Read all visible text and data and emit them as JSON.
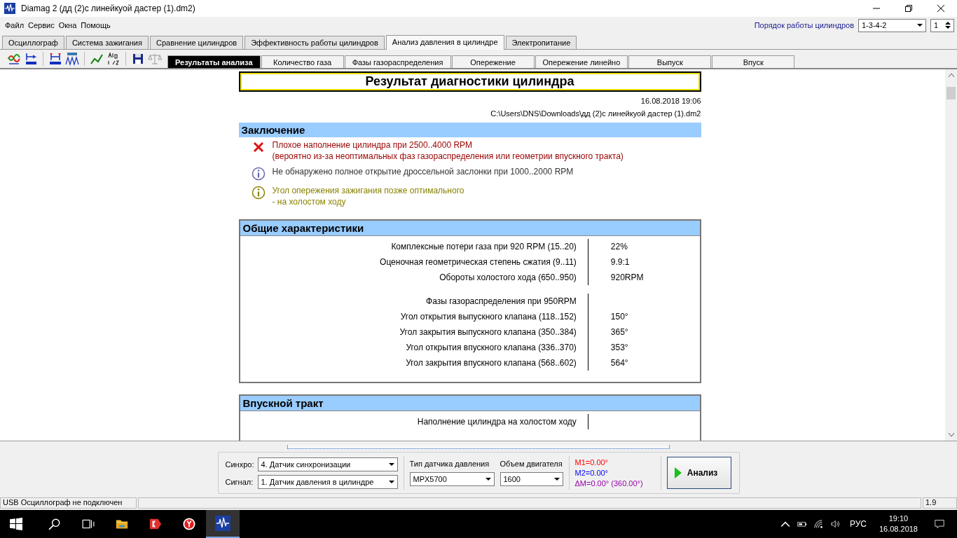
{
  "window": {
    "title": "Diamag 2 (дд (2)с линейкуой дастер (1).dm2)"
  },
  "menu": [
    "Файл",
    "Сервис",
    "Окна",
    "Помощь"
  ],
  "cylinder_order": {
    "label": "Порядок работы цилиндров",
    "value": "1-3-4-2",
    "cylinder": "1"
  },
  "tabs": [
    {
      "label": "Осциллограф",
      "selected": false
    },
    {
      "label": "Система зажигания",
      "selected": false
    },
    {
      "label": "Сравнение цилиндров",
      "selected": false
    },
    {
      "label": "Эффективность работы цилиндров",
      "selected": false
    },
    {
      "label": "Анализ давления в цилиндре",
      "selected": true
    },
    {
      "label": "Электропитание",
      "selected": false
    }
  ],
  "subtabs": [
    {
      "label": "Результаты анализа",
      "selected": true
    },
    {
      "label": "Количество газа",
      "selected": false
    },
    {
      "label": "Фазы газораспределения",
      "selected": false
    },
    {
      "label": "Опережение",
      "selected": false
    },
    {
      "label": "Опережение линейно",
      "selected": false
    },
    {
      "label": "Выпуск",
      "selected": false
    },
    {
      "label": "Впуск",
      "selected": false
    }
  ],
  "report": {
    "title": "Результат диагностики цилиндра",
    "date": "16.08.2018 19:06",
    "path": "C:\\Users\\DNS\\Downloads\\дд (2)с линейкуой дастер (1).dm2",
    "conclusion": {
      "title": "Заключение",
      "items": [
        {
          "kind": "error",
          "lines": [
            "Плохое наполнение цилиндра при 2500..4000 RPM",
            "(вероятно из-за неоптимальных фаз газораспределения или геометрии впускного тракта)"
          ]
        },
        {
          "kind": "info",
          "lines": [
            "Не обнаружено полное открытие дроссельной заслонки при 1000..2000 RPM"
          ]
        },
        {
          "kind": "warning",
          "lines": [
            "Угол опережения зажигания позже оптимального",
            "- на холостом ходу"
          ]
        }
      ]
    },
    "sections": [
      {
        "title": "Общие характеристики",
        "groups": [
          [
            {
              "label": "Комплексные потери газа при 920 RPM (15..20)",
              "value": "22%"
            },
            {
              "label": "Оценочная геометрическая степень сжатия (9..11)",
              "value": "9.9:1"
            },
            {
              "label": "Обороты холостого хода (650..950)",
              "value": "920RPM"
            }
          ],
          [
            {
              "label": "Фазы газораспределения при 950RPM"
            },
            {
              "label": "Угол открытия выпускного клапана (118..152)",
              "value": "150°"
            },
            {
              "label": "Угол закрытия выпускного клапана (350..384)",
              "value": "365°"
            },
            {
              "label": "Угол открытия впускного клапана (336..370)",
              "value": "353°"
            },
            {
              "label": "Угол закрытия впускного клапана (568..602)",
              "value": "564°"
            }
          ]
        ]
      },
      {
        "title": "Впускной тракт",
        "groups": [
          [
            {
              "label": "Наполнение цилиндра на холостом ходу"
            }
          ]
        ]
      }
    ]
  },
  "controls": {
    "sync_label": "Синхро:",
    "sync": "4.  Датчик синхронизации",
    "signal_label": "Сигнал:",
    "signal": "1.  Датчик давления в цилиндре",
    "sensor_label": "Тип датчика давления",
    "sensor": "MPX5700",
    "volume_label": "Объем двигателя",
    "volume": "1600",
    "markers": [
      {
        "text": "M1=0.00°",
        "color": "#ff0000"
      },
      {
        "text": "M2=0.00°",
        "color": "#0000ff"
      },
      {
        "text": "ΔM=0.00° (360.00°)",
        "color": "#9900aa"
      }
    ],
    "analyze": "Анализ"
  },
  "status_bar": {
    "message": "USB Осциллограф не подключен",
    "version": "1.9"
  },
  "taskbar": {
    "language": "РУС",
    "time": "19:10",
    "date": "16.08.2018"
  }
}
